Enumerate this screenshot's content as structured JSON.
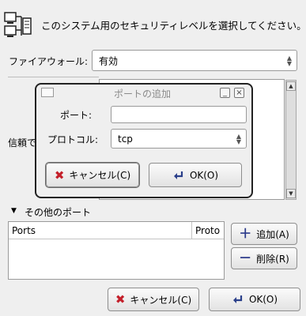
{
  "header": {
    "text": "このシステム用のセキュリティレベルを選択してください。",
    "icon": "network-computers-icon"
  },
  "firewall": {
    "label": "ファイアウォール:",
    "value": "有効"
  },
  "trusted": {
    "label_partial": "信頼で"
  },
  "other_ports": {
    "expander_label": "その他のポート",
    "columns": [
      "Ports",
      "Proto"
    ],
    "rows": [],
    "add_label": "追加(A)",
    "delete_label": "削除(R)"
  },
  "footer": {
    "cancel_label": "キャンセル(C)",
    "ok_label": "OK(O)"
  },
  "add_port_dialog": {
    "title": "ポートの追加",
    "port_label": "ポート:",
    "port_value": "",
    "protocol_label": "プロトコル:",
    "protocol_value": "tcp",
    "cancel_label": "キャンセル(C)",
    "ok_label": "OK(O)"
  },
  "colors": {
    "background": "#efefef",
    "cancel_icon": "#c4202b",
    "add_icon": "#2b3a8a"
  }
}
